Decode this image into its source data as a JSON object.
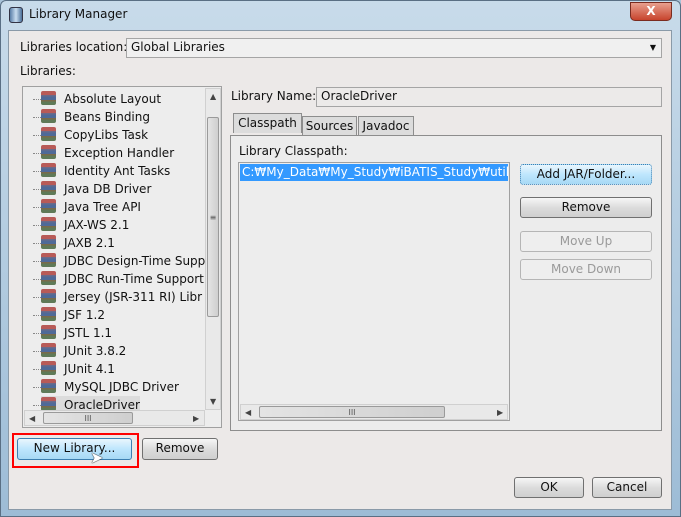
{
  "window": {
    "title": "Library Manager",
    "close_label": "X"
  },
  "location": {
    "label": "Libraries location:",
    "value": "Global Libraries"
  },
  "libraries": {
    "label": "Libraries:",
    "items": [
      "Absolute Layout",
      "Beans Binding",
      "CopyLibs Task",
      "Exception Handler",
      "Identity Ant Tasks",
      "Java DB Driver",
      "Java Tree API",
      "JAX-WS 2.1",
      "JAXB 2.1",
      "JDBC Design-Time Supp",
      "JDBC Run-Time Support",
      "Jersey (JSR-311 RI) Libr",
      "JSF 1.2",
      "JSTL 1.1",
      "JUnit 3.8.2",
      "JUnit 4.1",
      "MySQL JDBC Driver",
      "OracleDriver"
    ],
    "selected": "OracleDriver"
  },
  "library_name": {
    "label": "Library Name:",
    "value": "OracleDriver"
  },
  "tabs": [
    {
      "label": "Classpath",
      "active": true
    },
    {
      "label": "Sources"
    },
    {
      "label": "Javadoc"
    }
  ],
  "classpath": {
    "label": "Library Classpath:",
    "entries": [
      "C:₩My_Data₩My_Study₩iBATIS_Study₩util₩"
    ]
  },
  "buttons": {
    "add_jar": "Add JAR/Folder...",
    "remove": "Remove",
    "move_up": "Move Up",
    "move_down": "Move Down",
    "new_library": "New Library...",
    "remove_library": "Remove",
    "ok": "OK",
    "cancel": "Cancel"
  },
  "scroll_grip": "III",
  "colors": {
    "selection": "#3399ff",
    "highlight_box": "#ff0000"
  }
}
